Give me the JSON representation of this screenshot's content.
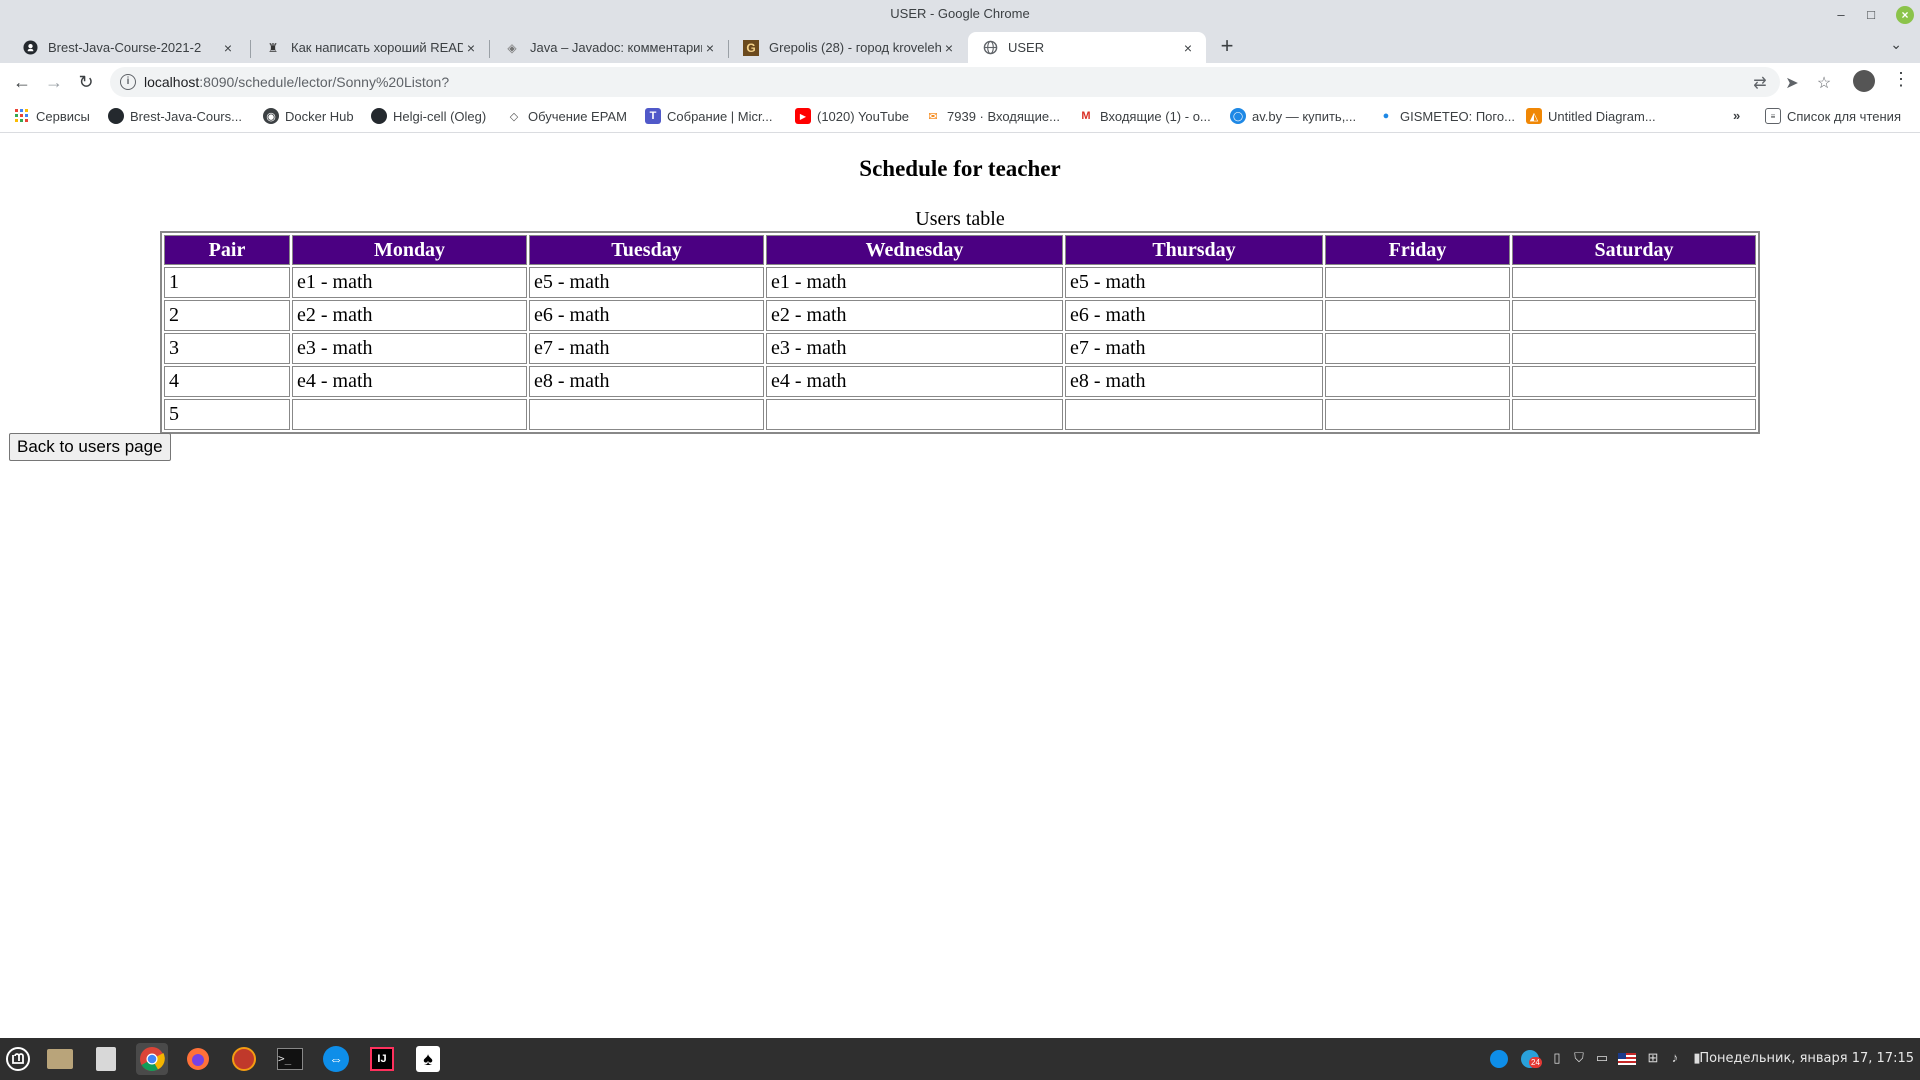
{
  "window": {
    "title": "USER - Google Chrome"
  },
  "tabs": [
    {
      "title": "Brest-Java-Course-2021-2",
      "icon": "github-icon"
    },
    {
      "title": "Как написать хороший README",
      "icon": "readme-icon"
    },
    {
      "title": "Java – Javadoc: комментарии",
      "icon": "javadoc-icon"
    },
    {
      "title": "Grepolis (28) - город kroveleh",
      "icon": "grepolis-icon"
    },
    {
      "title": "USER",
      "icon": "globe-icon"
    }
  ],
  "address_bar": {
    "host": "localhost",
    "path": ":8090/schedule/lector/Sonny%20Liston?"
  },
  "bookmarks": [
    {
      "label": "Сервисы",
      "icon": "apps-grid-icon"
    },
    {
      "label": "Brest-Java-Cours...",
      "icon": "github-icon"
    },
    {
      "label": "Docker Hub",
      "icon": "docker-icon"
    },
    {
      "label": "Helgi-cell (Oleg)",
      "icon": "github-icon"
    },
    {
      "label": "Обучение EPAM",
      "icon": "epam-icon"
    },
    {
      "label": "Собрание | Micr...",
      "icon": "teams-icon"
    },
    {
      "label": "(1020) YouTube",
      "icon": "youtube-icon"
    },
    {
      "label": "7939 · Входящие...",
      "icon": "mail-icon"
    },
    {
      "label": "Входящие (1) - o...",
      "icon": "gmail-icon"
    },
    {
      "label": "av.by — купить,...",
      "icon": "avby-icon"
    },
    {
      "label": "GISMETEO: Пого...",
      "icon": "gismeteo-icon"
    },
    {
      "label": "Untitled Diagram...",
      "icon": "drawio-icon"
    }
  ],
  "overflow_chevron": "»",
  "reading_list": "Список для чтения",
  "page": {
    "heading": "Schedule for teacher",
    "table_caption": "Users table",
    "columns": [
      "Pair",
      "Monday",
      "Tuesday",
      "Wednesday",
      "Thursday",
      "Friday",
      "Saturday"
    ],
    "rows": [
      [
        "1",
        "e1 - math",
        "e5 - math",
        "e1 - math",
        "e5 - math",
        "",
        ""
      ],
      [
        "2",
        "e2 - math",
        "e6 - math",
        "e2 - math",
        "e6 - math",
        "",
        ""
      ],
      [
        "3",
        "e3 - math",
        "e7 - math",
        "e3 - math",
        "e7 - math",
        "",
        ""
      ],
      [
        "4",
        "e4 - math",
        "e8 - math",
        "e4 - math",
        "e8 - math",
        "",
        ""
      ],
      [
        "5",
        "",
        "",
        "",
        "",
        "",
        ""
      ]
    ],
    "back_button": "Back to users page"
  },
  "taskbar": {
    "clock": "Понедельник, января 17, 17:15",
    "badge_count": "24"
  },
  "colors": {
    "table_header_bg": "#4b0082",
    "table_header_text": "#ffffff"
  }
}
